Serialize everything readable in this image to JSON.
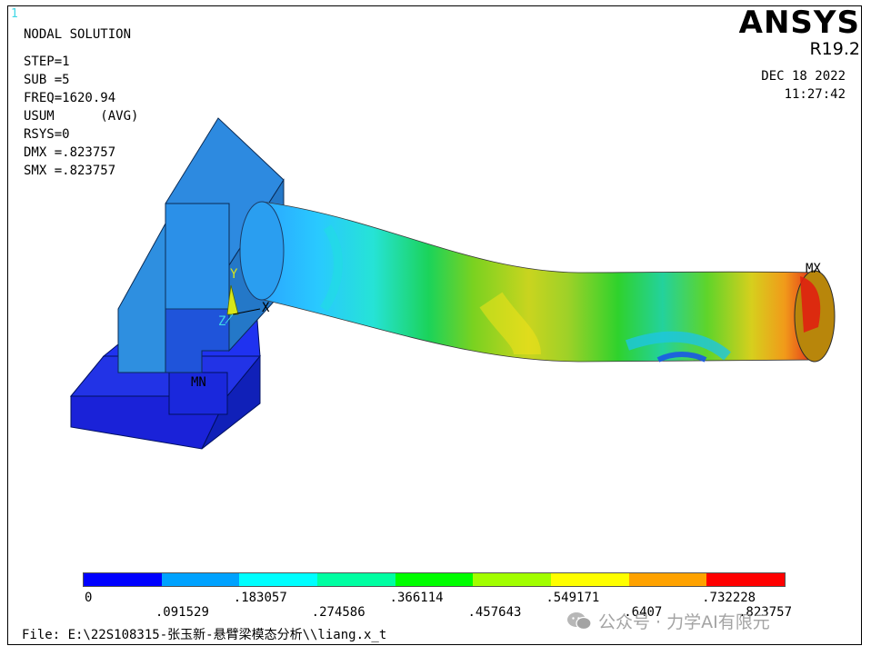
{
  "window_number": "1",
  "solution": {
    "title": "NODAL SOLUTION",
    "lines": [
      "STEP=1",
      "SUB =5",
      "FREQ=1620.94",
      "USUM      (AVG)",
      "RSYS=0",
      "DMX =.823757",
      "SMX =.823757"
    ]
  },
  "brand": {
    "logo": "ANSYS",
    "version": "R19.2"
  },
  "timestamp": {
    "date": "DEC 18 2022",
    "time": "11:27:42"
  },
  "viewport": {
    "axis_y": "Y",
    "axis_z": "Z",
    "axis_x": "X",
    "mx_label": "MX",
    "mn_label": "MN"
  },
  "legend": {
    "colors": [
      "#0000ff",
      "#00a2ff",
      "#00ffff",
      "#00ffa2",
      "#00ff00",
      "#a2ff00",
      "#ffff00",
      "#ffa200",
      "#ff0000"
    ],
    "labels": [
      "0",
      ".091529",
      ".183057",
      ".274586",
      ".366114",
      ".457643",
      ".549171",
      ".6407",
      ".732228",
      ".823757"
    ]
  },
  "file_line": "File: E:\\22S108315-张玉新-悬臂梁模态分析\\\\liang.x_t",
  "watermark": {
    "text": "公众号 · 力学AI有限元",
    "icon": "wechat-icon"
  }
}
